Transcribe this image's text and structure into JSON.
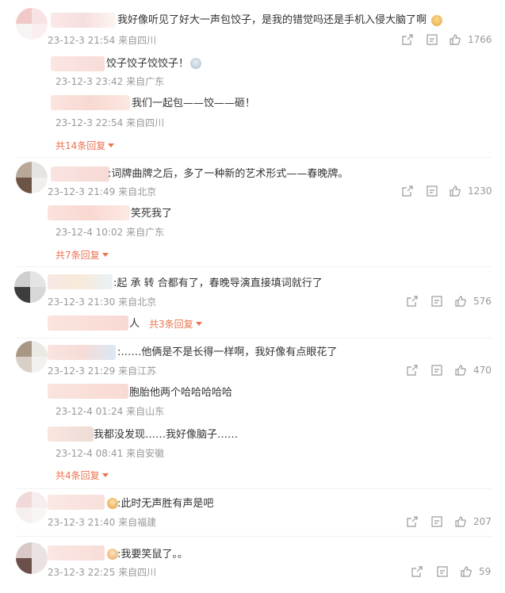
{
  "comments": [
    {
      "text": "我好像听见了好大一声包饺子，是我的错觉吗还是手机入侵大脑了啊",
      "date": "23-12-3 21:54",
      "location": "来自四川",
      "likes": "1766",
      "replies": [
        {
          "text": "饺子饺子饺饺子！",
          "date": "23-12-3 23:42",
          "location": "来自广东"
        },
        {
          "text": "我们一起包——饺——砸！",
          "date": "23-12-3 22:54",
          "location": "来自四川"
        }
      ],
      "more_label": "共14条回复"
    },
    {
      "text": ":词牌曲牌之后，多了一种新的艺术形式——春晚牌。",
      "date": "23-12-3 21:49",
      "location": "来自北京",
      "likes": "1230",
      "replies": [
        {
          "text": "笑死我了",
          "date": "23-12-4 10:02",
          "location": "来自广东"
        }
      ],
      "more_label": "共7条回复"
    },
    {
      "text": ":起  承  转  合都有了，春晚导演直接填词就行了",
      "date": "23-12-3 21:30",
      "location": "来自北京",
      "likes": "576",
      "inline_reply_tail": "人",
      "more_label": "共3条回复"
    },
    {
      "text": ":……他俩是不是长得一样啊，我好像有点眼花了",
      "date": "23-12-3 21:29",
      "location": "来自江苏",
      "likes": "470",
      "replies": [
        {
          "text": "胞胎他两个哈哈哈哈哈",
          "date": "23-12-4 01:24",
          "location": "来自山东"
        },
        {
          "text": "我都没发现……我好像脑子……",
          "date": "23-12-4 08:41",
          "location": "来自安徽"
        }
      ],
      "more_label": "共4条回复"
    },
    {
      "text": ":此时无声胜有声是吧",
      "date": "23-12-3 21:40",
      "location": "来自福建",
      "likes": "207"
    },
    {
      "text": ":我要笑鼠了。。",
      "date": "23-12-3 22:25",
      "location": "来自四川",
      "likes": "59"
    }
  ],
  "icons": {
    "share": "share-icon",
    "comment": "comment-icon",
    "like": "thumbs-up-icon"
  },
  "colors": {
    "accent": "#eb7350",
    "meta": "#999999",
    "text": "#333333"
  }
}
